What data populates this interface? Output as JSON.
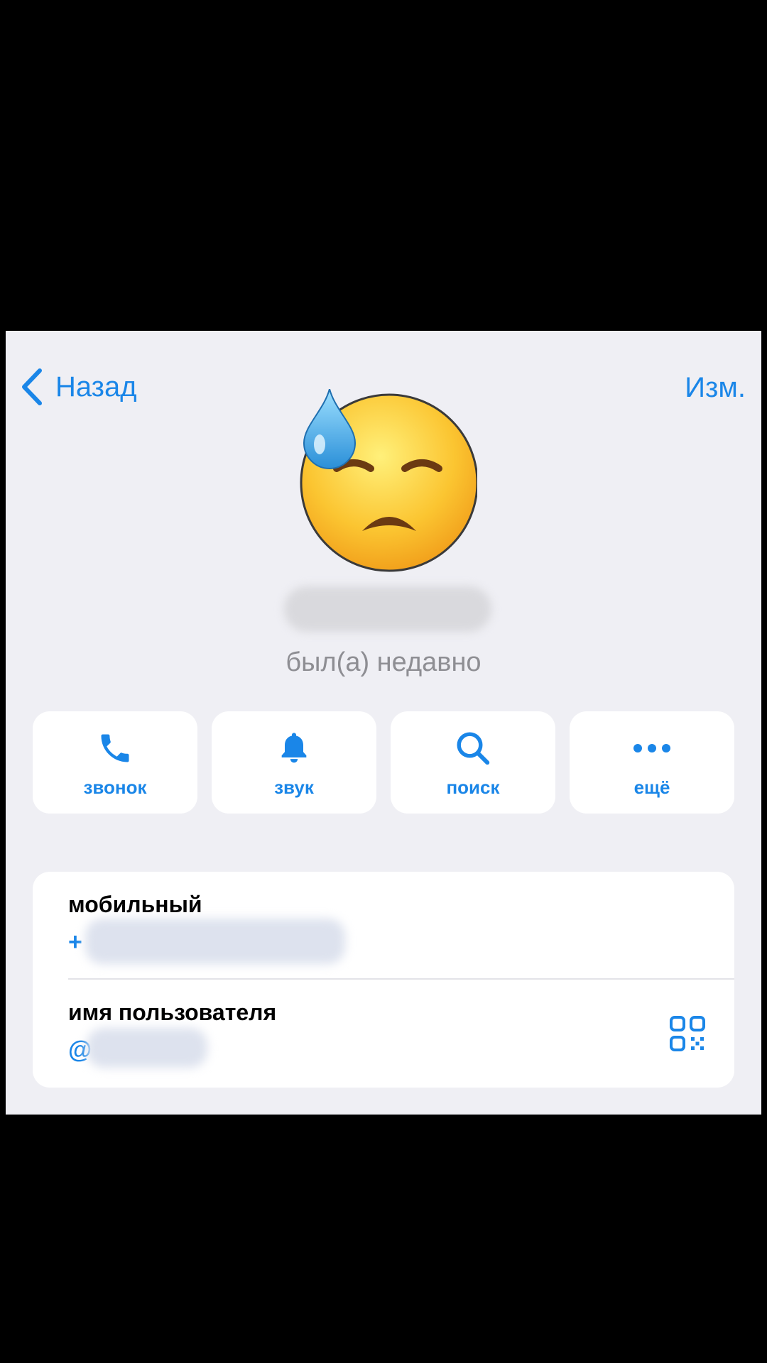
{
  "nav": {
    "back_label": "Назад",
    "edit_label": "Изм."
  },
  "profile": {
    "avatar_icon": "downcast-face-with-sweat-emoji-icon",
    "status": "был(а) недавно"
  },
  "actions": [
    {
      "label": "звонок",
      "icon": "phone-icon"
    },
    {
      "label": "звук",
      "icon": "bell-icon"
    },
    {
      "label": "поиск",
      "icon": "search-icon"
    },
    {
      "label": "ещё",
      "icon": "more-dots-icon"
    }
  ],
  "info": {
    "mobile_label": "мобильный",
    "mobile_prefix": "+",
    "username_label": "имя пользователя",
    "username_prefix": "@",
    "qr_icon": "qr-code-icon"
  },
  "colors": {
    "accent": "#1a86e8",
    "background": "#efeff4",
    "status_text": "#8e8e93"
  }
}
